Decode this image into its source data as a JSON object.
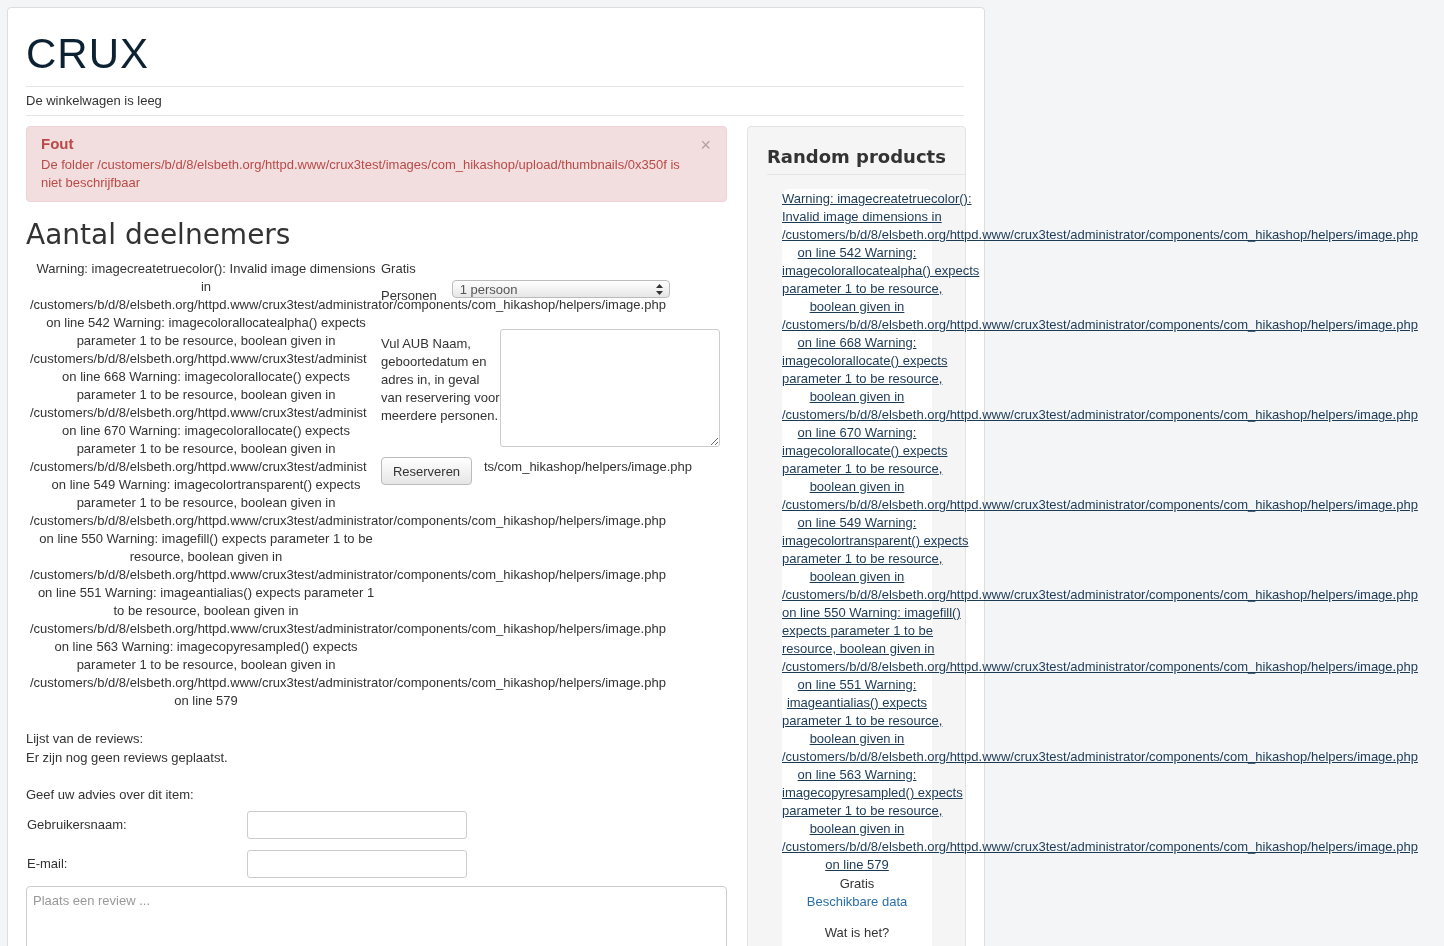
{
  "site": {
    "title": "CRUX",
    "cart_status": "De winkelwagen is leeg"
  },
  "alert": {
    "title": "Fout",
    "message": "De folder /customers/b/d/8/elsbeth.org/httpd.www/crux3test/images/com_hikashop/upload/thumbnails/0x350f is niet beschrijfbaar",
    "close": "×"
  },
  "heading": "Aantal deelnemers",
  "warning_lines": [
    {
      "kind": "text",
      "text": "Warning: imagecreatetruecolor(): Invalid image dimensions"
    },
    {
      "kind": "text",
      "text": "in"
    },
    {
      "kind": "path",
      "text": "/customers/b/d/8/elsbeth.org/httpd.www/crux3test/administrator/components/com_hikashop/helpers/image.php"
    },
    {
      "kind": "text",
      "text": "on line 542 Warning: imagecolorallocatealpha() expects"
    },
    {
      "kind": "text",
      "text": "parameter 1 to be resource, boolean given in"
    },
    {
      "kind": "path",
      "text": "/customers/b/d/8/elsbeth.org/httpd.www/crux3test/administ"
    },
    {
      "kind": "text",
      "text": "on line 668 Warning: imagecolorallocate() expects"
    },
    {
      "kind": "text",
      "text": "parameter 1 to be resource, boolean given in"
    },
    {
      "kind": "path",
      "text": "/customers/b/d/8/elsbeth.org/httpd.www/crux3test/administ"
    },
    {
      "kind": "text",
      "text": "on line 670 Warning: imagecolorallocate() expects"
    },
    {
      "kind": "text",
      "text": "parameter 1 to be resource, boolean given in"
    },
    {
      "kind": "path",
      "text": "/customers/b/d/8/elsbeth.org/httpd.www/crux3test/administ",
      "tail": "ts/com_hikashop/helpers/image.php"
    },
    {
      "kind": "text",
      "text": "on line 549 Warning: imagecolortransparent() expects"
    },
    {
      "kind": "text",
      "text": "parameter 1 to be resource, boolean given in"
    },
    {
      "kind": "path",
      "text": "/customers/b/d/8/elsbeth.org/httpd.www/crux3test/administrator/components/com_hikashop/helpers/image.php"
    },
    {
      "kind": "text",
      "text": "on line 550 Warning: imagefill() expects parameter 1 to be"
    },
    {
      "kind": "text",
      "text": "resource, boolean given in"
    },
    {
      "kind": "path",
      "text": "/customers/b/d/8/elsbeth.org/httpd.www/crux3test/administrator/components/com_hikashop/helpers/image.php"
    },
    {
      "kind": "text",
      "text": "on line 551 Warning: imageantialias() expects parameter 1"
    },
    {
      "kind": "text",
      "text": "to be resource, boolean given in"
    },
    {
      "kind": "path",
      "text": "/customers/b/d/8/elsbeth.org/httpd.www/crux3test/administrator/components/com_hikashop/helpers/image.php"
    },
    {
      "kind": "text",
      "text": "on line 563 Warning: imagecopyresampled() expects"
    },
    {
      "kind": "text",
      "text": "parameter 1 to be resource, boolean given in"
    },
    {
      "kind": "path",
      "text": "/customers/b/d/8/elsbeth.org/httpd.www/crux3test/administrator/components/com_hikashop/helpers/image.php"
    },
    {
      "kind": "text",
      "text": "on line 579"
    }
  ],
  "reservation": {
    "price": "Gratis",
    "persons_label": "Personen",
    "persons_value": "1 persoon",
    "note": "Vul AUB Naam, geboortedatum en adres in, in geval van reservering voor meerdere personen.",
    "button": "Reserveren"
  },
  "reviews": {
    "list_label": "Lijst van de reviews:",
    "empty": "Er zijn nog geen reviews geplaatst.",
    "prompt": "Geef uw advies over dit item:",
    "username_label": "Gebruikersnaam:",
    "email_label": "E-mail:",
    "review_placeholder": "Plaats een review ..."
  },
  "sidebar": {
    "title": "Random products",
    "warning_lines": [
      {
        "kind": "text",
        "text": "Warning: imagecreatetruecolor():"
      },
      {
        "kind": "text",
        "text": "Invalid image dimensions in"
      },
      {
        "kind": "path",
        "text": "/customers/b/d/8/elsbeth.org/httpd.www/crux3test/administrator/components/com_hikashop/helpers/image.php"
      },
      {
        "kind": "text",
        "text": "on line 542 Warning:"
      },
      {
        "kind": "text",
        "text": "imagecolorallocatealpha() expects"
      },
      {
        "kind": "text",
        "text": "parameter 1 to be resource,"
      },
      {
        "kind": "text",
        "text": "boolean given in"
      },
      {
        "kind": "path",
        "text": "/customers/b/d/8/elsbeth.org/httpd.www/crux3test/administrator/components/com_hikashop/helpers/image.php"
      },
      {
        "kind": "text",
        "text": "on line 668 Warning:"
      },
      {
        "kind": "text",
        "text": "imagecolorallocate() expects"
      },
      {
        "kind": "text",
        "text": "parameter 1 to be resource,"
      },
      {
        "kind": "text",
        "text": "boolean given in"
      },
      {
        "kind": "path",
        "text": "/customers/b/d/8/elsbeth.org/httpd.www/crux3test/administrator/components/com_hikashop/helpers/image.php"
      },
      {
        "kind": "text",
        "text": "on line 670 Warning:"
      },
      {
        "kind": "text",
        "text": "imagecolorallocate() expects"
      },
      {
        "kind": "text",
        "text": "parameter 1 to be resource,"
      },
      {
        "kind": "text",
        "text": "boolean given in"
      },
      {
        "kind": "path",
        "text": "/customers/b/d/8/elsbeth.org/httpd.www/crux3test/administrator/components/com_hikashop/helpers/image.php"
      },
      {
        "kind": "text",
        "text": "on line 549 Warning:"
      },
      {
        "kind": "text",
        "text": "imagecolortransparent() expects"
      },
      {
        "kind": "text",
        "text": "parameter 1 to be resource,"
      },
      {
        "kind": "text",
        "text": "boolean given in"
      },
      {
        "kind": "path",
        "text": "/customers/b/d/8/elsbeth.org/httpd.www/crux3test/administrator/components/com_hikashop/helpers/image.php"
      },
      {
        "kind": "text",
        "text": "on line 550 Warning: imagefill()"
      },
      {
        "kind": "text",
        "text": "expects parameter 1 to be"
      },
      {
        "kind": "text",
        "text": "resource, boolean given in"
      },
      {
        "kind": "path",
        "text": "/customers/b/d/8/elsbeth.org/httpd.www/crux3test/administrator/components/com_hikashop/helpers/image.php"
      },
      {
        "kind": "text",
        "text": "on line 551 Warning:"
      },
      {
        "kind": "text",
        "text": "imageantialias() expects"
      },
      {
        "kind": "text",
        "text": "parameter 1 to be resource,"
      },
      {
        "kind": "text",
        "text": "boolean given in"
      },
      {
        "kind": "path",
        "text": "/customers/b/d/8/elsbeth.org/httpd.www/crux3test/administrator/components/com_hikashop/helpers/image.php"
      },
      {
        "kind": "text",
        "text": "on line 563 Warning:"
      },
      {
        "kind": "text",
        "text": "imagecopyresampled() expects"
      },
      {
        "kind": "text",
        "text": "parameter 1 to be resource,"
      },
      {
        "kind": "text",
        "text": "boolean given in"
      },
      {
        "kind": "path",
        "text": "/customers/b/d/8/elsbeth.org/httpd.www/crux3test/administrator/components/com_hikashop/helpers/image.php"
      },
      {
        "kind": "text",
        "text": "on line 579"
      }
    ],
    "price": "Gratis",
    "dates_link": "Beschikbare data",
    "info": "Wat is het?"
  }
}
